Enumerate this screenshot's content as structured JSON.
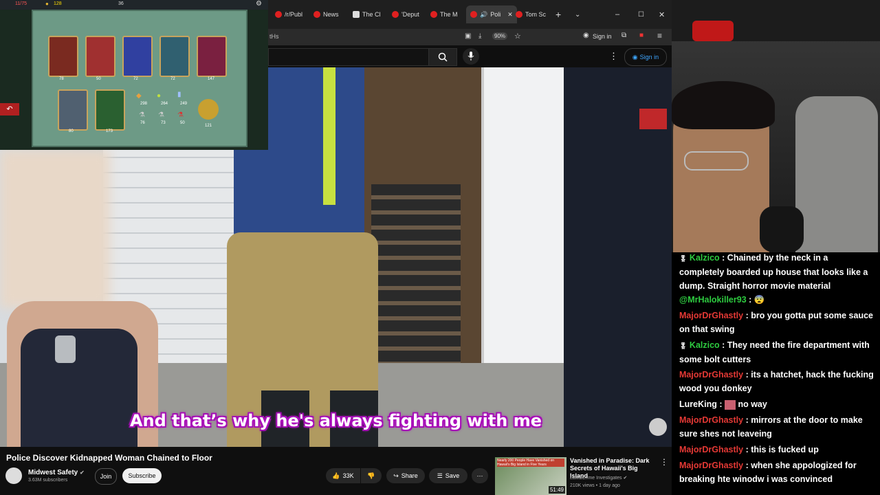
{
  "browser": {
    "tabs": [
      {
        "label": "/r/Publ",
        "icon": "reddit-icon"
      },
      {
        "label": "News",
        "icon": "reddit-icon"
      },
      {
        "label": "The Cl",
        "icon": "wiki-icon"
      },
      {
        "label": "'Deput",
        "icon": "youtube-icon"
      },
      {
        "label": "The M",
        "icon": "youtube-icon"
      },
      {
        "label": "Poli",
        "icon": "youtube-icon",
        "active": true
      },
      {
        "label": "Tom Sc",
        "icon": "youtube-icon"
      }
    ],
    "address_fragment": "tHs",
    "zoom": "90%",
    "sign_in_label": "Sign in"
  },
  "youtube": {
    "sign_in_label": "Sign in",
    "caption": "And that’s why he's always fighting with me",
    "video_title": "Police Discover Kidnapped Woman Chained to Floor",
    "channel": {
      "name": "Midwest Safety",
      "subscribers": "3.63M subscribers"
    },
    "join_label": "Join",
    "subscribe_label": "Subscribe",
    "likes": "33K",
    "share_label": "Share",
    "save_label": "Save",
    "recommended": {
      "title": "Vanished in Paradise: Dark Secrets of Hawaii's Big Island",
      "channel": "Law&Crime Investigates",
      "meta": "210K views • 1 day ago",
      "duration": "51:49",
      "thumb_text": "Nearly 200 People Have Vanished on Hawaii's Big Island in Five Years"
    }
  },
  "game": {
    "hp": "11/75",
    "gold": "128",
    "floor": "36",
    "card_prices": [
      "78",
      "50",
      "72",
      "72",
      "147",
      "80",
      "173"
    ],
    "relic_prices": [
      "298",
      "264",
      "249",
      "76",
      "73",
      "50",
      "121"
    ]
  },
  "chat": [
    {
      "user": "Kalzico",
      "user_color": "#2ecc40",
      "badge": true,
      "text": "Chained by the neck in a completely boarded up house that looks like a dump. Straight horror movie material",
      "partial": true
    },
    {
      "user": "@MrHalokiller93",
      "user_color": "#2ecc40",
      "text": "😨"
    },
    {
      "user": "MajorDrGhastly",
      "user_color": "#e53935",
      "text": "bro you gotta put some sauce on that swing"
    },
    {
      "user": "Kalzico",
      "user_color": "#2ecc40",
      "badge": true,
      "text": "They need the fire department with some bolt cutters"
    },
    {
      "user": "MajorDrGhastly",
      "user_color": "#e53935",
      "text": "its a hatchet, hack the fucking wood you donkey"
    },
    {
      "user": "LureKing",
      "user_color": "#ffffff",
      "text": "no way"
    },
    {
      "user": "MajorDrGhastly",
      "user_color": "#e53935",
      "text": "mirrors at the door to make sure shes not leaveing"
    },
    {
      "user": "MajorDrGhastly",
      "user_color": "#e53935",
      "text": "this is fucked up"
    },
    {
      "user": "MajorDrGhastly",
      "user_color": "#e53935",
      "text": "when she appologized for breaking hte winodw i was convinced"
    }
  ]
}
